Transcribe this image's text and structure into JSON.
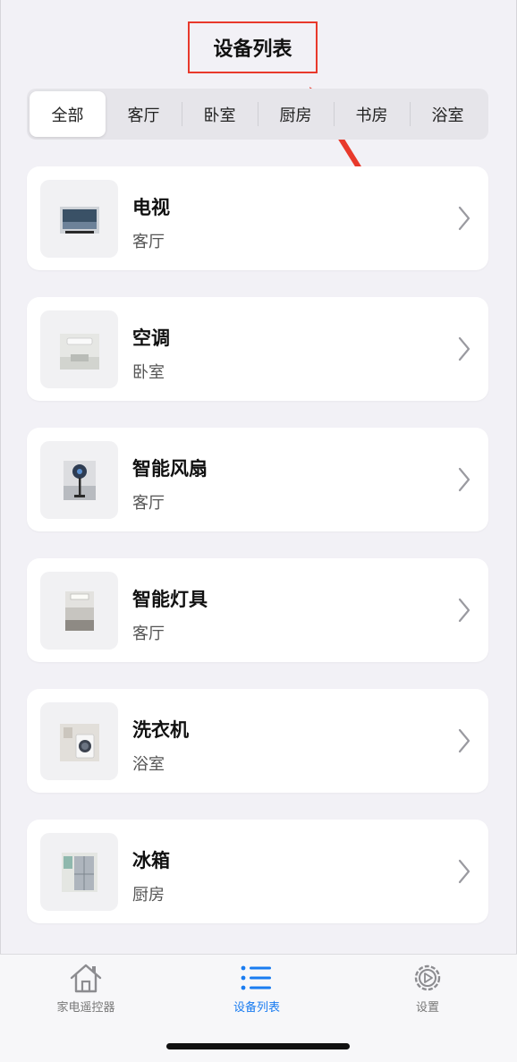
{
  "header": {
    "title": "设备列表"
  },
  "filters": {
    "items": [
      "全部",
      "客厅",
      "卧室",
      "厨房",
      "书房",
      "浴室"
    ],
    "selected": "全部"
  },
  "devices": [
    {
      "name": "电视",
      "room": "客厅",
      "icon": "tv-icon"
    },
    {
      "name": "空调",
      "room": "卧室",
      "icon": "air-conditioner-icon"
    },
    {
      "name": "智能风扇",
      "room": "客厅",
      "icon": "fan-icon"
    },
    {
      "name": "智能灯具",
      "room": "客厅",
      "icon": "ceiling-light-icon"
    },
    {
      "name": "洗衣机",
      "room": "浴室",
      "icon": "washing-machine-icon"
    },
    {
      "name": "冰箱",
      "room": "厨房",
      "icon": "refrigerator-icon"
    }
  ],
  "tabbar": {
    "items": [
      {
        "label": "家电遥控器",
        "icon": "home-icon",
        "active": false
      },
      {
        "label": "设备列表",
        "icon": "list-icon",
        "active": true
      },
      {
        "label": "设置",
        "icon": "gear-icon",
        "active": false
      }
    ]
  },
  "colors": {
    "accent": "#1a7cf0",
    "annotation": "#e8392b",
    "background": "#f2f1f6"
  }
}
